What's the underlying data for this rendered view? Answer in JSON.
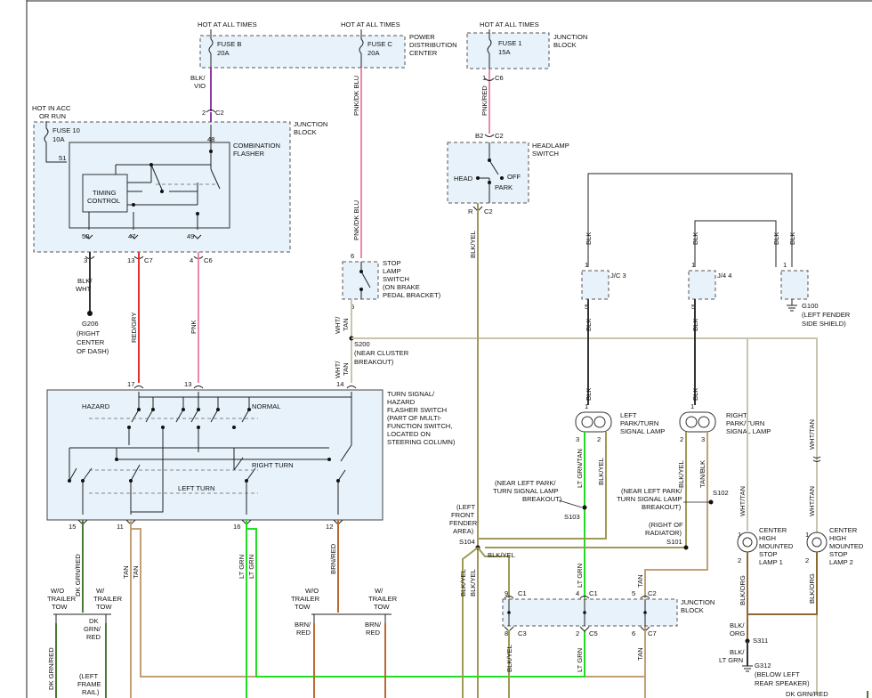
{
  "labels": {
    "hot_all_times_1": "HOT AT ALL TIMES",
    "hot_all_times_2": "HOT AT ALL TIMES",
    "hot_all_times_3": "HOT AT ALL TIMES",
    "fuse_b": "FUSE B",
    "fuse_b_amp": "20A",
    "fuse_c": "FUSE C",
    "fuse_c_amp": "20A",
    "pdc_1": "POWER",
    "pdc_2": "DISTRIBUTION",
    "pdc_3": "CENTER",
    "fuse_1": "FUSE 1",
    "fuse_1_amp": "15A",
    "jb_top_1": "JUNCTION",
    "jb_top_2": "BLOCK",
    "hot_acc_1": "HOT IN ACC",
    "hot_acc_2": "OR RUN",
    "fuse_10": "FUSE 10",
    "fuse_10_amp": "10A",
    "jb_left_1": "JUNCTION",
    "jb_left_2": "BLOCK",
    "combo_1": "COMBINATION",
    "combo_2": "FLASHER",
    "timing_1": "TIMING",
    "timing_2": "CONTROL",
    "headlamp_1": "HEADLAMP",
    "headlamp_2": "SWITCH",
    "head": "HEAD",
    "park": "PARK",
    "off": "OFF",
    "stop_1": "STOP",
    "stop_2": "LAMP",
    "stop_3": "SWITCH",
    "stop_4": "(ON BRAKE",
    "stop_5": "PEDAL BRACKET)",
    "g206_1": "G206",
    "g206_2": "(RIGHT",
    "g206_3": "CENTER",
    "g206_4": "OF DASH)",
    "s200_1": "S200",
    "s200_2": "(NEAR CLUSTER",
    "s200_3": "BREAKOUT)",
    "g100_1": "G100",
    "g100_2": "(LEFT FENDER",
    "g100_3": "SIDE SHIELD)",
    "jc3": "J/C 3",
    "j44": "J/4 4",
    "turn_1": "TURN SIGNAL/",
    "turn_2": "HAZARD",
    "turn_3": "FLASHER SWITCH",
    "turn_4": "(PART OF MULTI-",
    "turn_5": "FUNCTION SWITCH,",
    "turn_6": "LOCATED ON",
    "turn_7": "STEERING COLUMN)",
    "hazard": "HAZARD",
    "normal": "NORMAL",
    "right_turn": "RIGHT TURN",
    "left_turn": "LEFT TURN",
    "left_lamp_1": "LEFT",
    "left_lamp_2": "PARK/TURN",
    "left_lamp_3": "SIGNAL LAMP",
    "right_lamp_1": "RIGHT",
    "right_lamp_2": "PARK/TURN",
    "right_lamp_3": "SIGNAL LAMP",
    "near_left_1": "(NEAR LEFT PARK/",
    "near_left_2": "TURN SIGNAL LAMP",
    "near_left_3": "BREAKOUT)",
    "s103": "S103",
    "near_left_b1": "(NEAR LEFT PARK/",
    "near_left_b2": "TURN SIGNAL LAMP",
    "near_left_b3": "BREAKOUT)",
    "s102": "S102",
    "right_rad_1": "(RIGHT OF",
    "right_rad_2": "RADIATOR)",
    "s101": "S101",
    "left_front_1": "(LEFT",
    "left_front_2": "FRONT",
    "left_front_3": "FENDER",
    "left_front_4": "AREA)",
    "s104": "S104",
    "jb_bottom_1": "JUNCTION",
    "jb_bottom_2": "BLOCK",
    "chmsl1_1": "CENTER",
    "chmsl1_2": "HIGH",
    "chmsl1_3": "MOUNTED",
    "chmsl1_4": "STOP",
    "chmsl1_5": "LAMP 1",
    "chmsl2_1": "CENTER",
    "chmsl2_2": "HIGH",
    "chmsl2_3": "MOUNTED",
    "chmsl2_4": "STOP",
    "chmsl2_5": "LAMP 2",
    "s311": "S311",
    "g312_1": "G312",
    "g312_2": "(BELOW LEFT",
    "g312_3": "REAR SPEAKER)",
    "wo_tow_1a": "W/O",
    "wo_tow_1b": "TRAILER",
    "wo_tow_1c": "TOW",
    "w_tow_1a": "W/",
    "w_tow_1b": "TRAILER",
    "w_tow_1c": "TOW",
    "wo_tow_2a": "W/O",
    "wo_tow_2b": "TRAILER",
    "wo_tow_2c": "TOW",
    "w_tow_2a": "W/",
    "w_tow_2b": "TRAILER",
    "w_tow_2c": "TOW",
    "left_frame_1": "(LEFT",
    "left_frame_2": "FRAME",
    "left_frame_3": "RAIL)"
  },
  "wire_labels": {
    "blk_vio_1": "BLK/",
    "blk_vio_2": "VIO",
    "pnk_dkblu_top": "PNK/DK BLU",
    "pnk_red": "PNK/RED",
    "pnk_dkblu_mid": "PNK/DK BLU",
    "blk_yel_mid": "BLK/YEL",
    "blk_wht_1": "BLK/",
    "blk_wht_2": "WHT",
    "red_gry": "RED/GRY",
    "pnk": "PNK",
    "wht_tan_1a": "WHT/",
    "wht_tan_1b": "TAN",
    "wht_tan_2a": "WHT/",
    "wht_tan_2b": "TAN",
    "blk_l1": "BLK",
    "blk_l2": "BLK",
    "blk_l3": "BLK",
    "blk_r1": "BLK",
    "blk_r2": "BLK",
    "blk_g": "BLK",
    "lt_grn_tan": "LT GRN/TAN",
    "blk_yel_left": "BLK/YEL",
    "blk_yel_right": "BLK/YEL",
    "tan_blk": "TAN/BLK",
    "wht_tan_right": "WHT/TAN",
    "wht_tan_c1": "WHT/TAN",
    "wht_tan_c2": "WHT/TAN",
    "blk_org_1": "BLK/ORG",
    "blk_org_2": "BLK/ORG",
    "blk_org_s311a": "BLK/",
    "blk_org_s311b": "ORG",
    "blk_ltgrn_a": "BLK/",
    "blk_ltgrn_b": "LT GRN",
    "blk_yel_s104": "BLK/YEL",
    "blk_yel_a": "BLK/YEL",
    "blk_yel_b": "BLK/YEL",
    "lt_grn_c1": "LT GRN",
    "tan_c2": "TAN",
    "blk_yel_c3": "BLK/YEL",
    "lt_grn_c5": "LT GRN",
    "tan_c7": "TAN",
    "dk_grn_red": "DK GRN/RED",
    "tan_11a": "TAN",
    "tan_11b": "TAN",
    "lt_grn_16a": "LT GRN",
    "lt_grn_16b": "LT GRN",
    "brn_red_12": "BRN/RED",
    "dk_grn_red_b1": "DK",
    "dk_grn_red_b2": "GRN/",
    "dk_grn_red_b3": "RED",
    "dk_grn_red_low": "DK GRN/RED",
    "brn_red_a1": "BRN/",
    "brn_red_a2": "RED",
    "brn_red_b1": "BRN/",
    "brn_red_b2": "RED",
    "dk_grn_red_corner": "DK GRN/RED"
  },
  "pins": {
    "p_fb": "2",
    "c_fb": "C2",
    "p_fuse1": "1",
    "c_fuse1": "C6",
    "p_b2": "B2",
    "c_b2": "C2",
    "p_r": "R",
    "c_r": "C2",
    "p_48": "48",
    "p_51": "51",
    "p_50": "50",
    "p_47": "47",
    "p_49": "49",
    "p_3": "3",
    "p_13": "13",
    "c_13": "C7",
    "p_4": "4",
    "c_4": "C6",
    "p_6": "6",
    "p_5": "5",
    "p_17": "17",
    "p_13b": "13",
    "p_14": "14",
    "p_15": "15",
    "p_11": "11",
    "p_16": "16",
    "p_12": "12",
    "p_jc3_1": "1",
    "p_jc3_5": "5",
    "p_j44_1": "1",
    "p_j44_5": "5",
    "p_g100": "1",
    "p_ll1": "1",
    "p_ll3": "3",
    "p_ll2": "2",
    "p_rl1": "1",
    "p_rl2": "2",
    "p_rl3": "3",
    "p_c1_9": "9",
    "c_c1_9": "C1",
    "p_c1_4": "4",
    "c_c1_4": "C1",
    "p_c2_5": "5",
    "c_c2_5": "C2",
    "p_c3_8": "8",
    "c_c3_8": "C3",
    "p_c5_2": "2",
    "c_c5_2": "C5",
    "p_c7_6": "6",
    "c_c7_6": "C7",
    "p_ch1_1": "1",
    "p_ch1_2": "2",
    "p_ch2_1": "1",
    "p_ch2_2": "2"
  },
  "colors": {
    "black": "#222222",
    "violet": "#8a3aa0",
    "pink": "#ee88aa",
    "red_gry": "#e03030",
    "blk_yel": "#a09a58",
    "wht_tan": "#c9c4ae",
    "lt_grn": "#22dd22",
    "tan": "#c2a075",
    "brn_red": "#b86a30",
    "dk_grn_red": "#4a7a3a",
    "blk_org": "#8b6a30",
    "box_fill": "#e7f2fa"
  }
}
